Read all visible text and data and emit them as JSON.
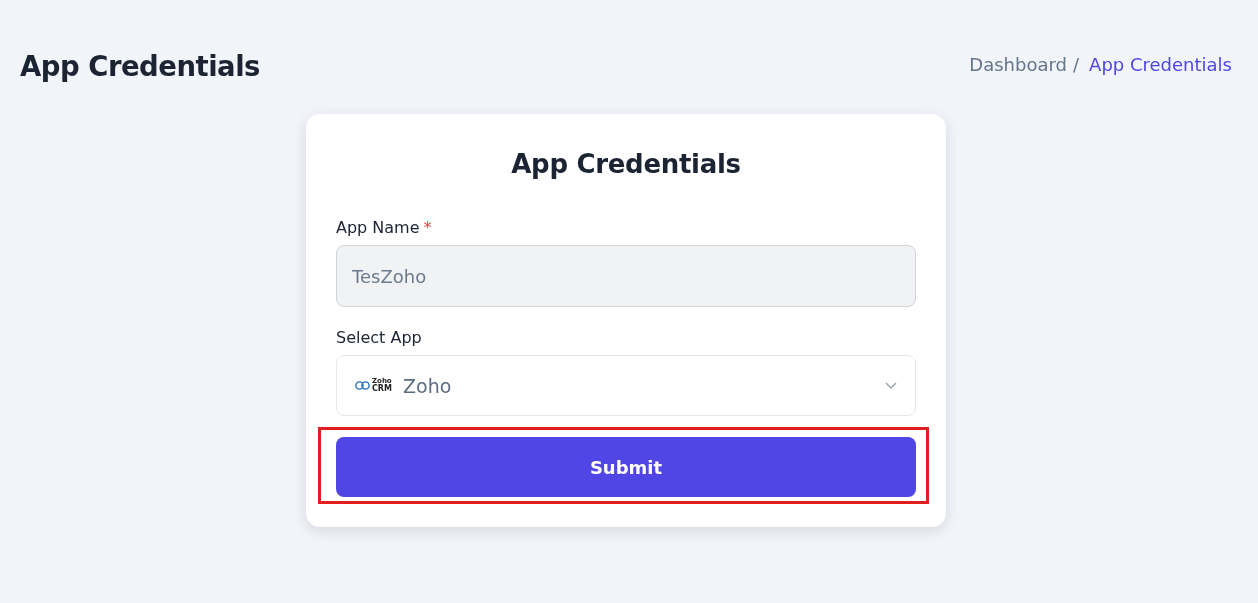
{
  "header": {
    "title": "App Credentials",
    "breadcrumb": [
      {
        "label": "Dashboard",
        "current": false
      },
      {
        "label": "App Credentials",
        "current": true
      }
    ],
    "separator": "/"
  },
  "card": {
    "title": "App Credentials",
    "fields": [
      {
        "kind": "text",
        "label": "App Name",
        "required_mark": "*",
        "value": "TesZoho",
        "disabled": true
      },
      {
        "kind": "select",
        "label": "Select App",
        "value": "Zoho",
        "logo_text": [
          "Zoho",
          "CRM"
        ],
        "disabled": false
      }
    ],
    "submit": {
      "label": "Submit",
      "highlighted": true
    }
  }
}
